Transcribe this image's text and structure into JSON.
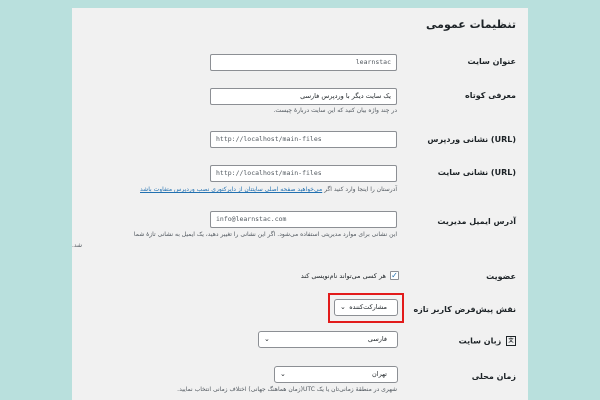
{
  "page_title": "تنظیمات عمومی",
  "fields": {
    "site_title": {
      "label": "عنوان سایت",
      "value": "learnstac"
    },
    "tagline": {
      "label": "معرفی کوتاه",
      "value": "یک سایت دیگر با وردپرس فارسی",
      "description": "در چند واژه بیان کنید که این سایت درباره‌ٔ چیست."
    },
    "wp_url": {
      "label": "نشانی وردپرس (URL)",
      "value": "http://localhost/main-files"
    },
    "site_url": {
      "label": "نشانی سایت (URL)",
      "value": "http://localhost/main-files",
      "description_prefix": "آدرستان را اینجا وارد کنید اگر ",
      "description_link": "می‌خواهید صفحه اصلی سایتتان از دایرکتوری نصب وردپرس متفاوت باشد"
    },
    "admin_email": {
      "label": "آدرس ایمیل مدیریت",
      "value": "info@learnstac.com",
      "description_line1": "این نشانی برای موارد مدیریتی استفاده می‌شود. اگر این نشانی را تغییر دهید، یک ایمیل به نشانی تازهٔ شما",
      "description_line2": "شد."
    },
    "membership": {
      "label": "عضویت",
      "checkbox_label": "هر کسی می‌تواند نام‌نویسی کند",
      "checked": true
    },
    "default_role": {
      "label": "نقش پیش‌فرض کاربر تازه",
      "value": "مشارکت‌کننده"
    },
    "site_language": {
      "label": "زبان سایت",
      "value": "فارسی"
    },
    "timezone": {
      "label": "زمان محلی",
      "value": "تهران",
      "description": "شهری در منطقهٔ زمانی‌تان یا یک UTC(زمان هماهنگ جهانی) اختلاف زمانی انتخاب نمایید."
    }
  },
  "icons": {
    "chevron": "chevron-down-icon",
    "checkmark": "checkmark-icon",
    "translation": "translation-icon"
  },
  "colors": {
    "background": "#b9e0dd",
    "panel": "#f1f1f1",
    "link": "#2271b1",
    "highlight": "#e21b1b"
  }
}
